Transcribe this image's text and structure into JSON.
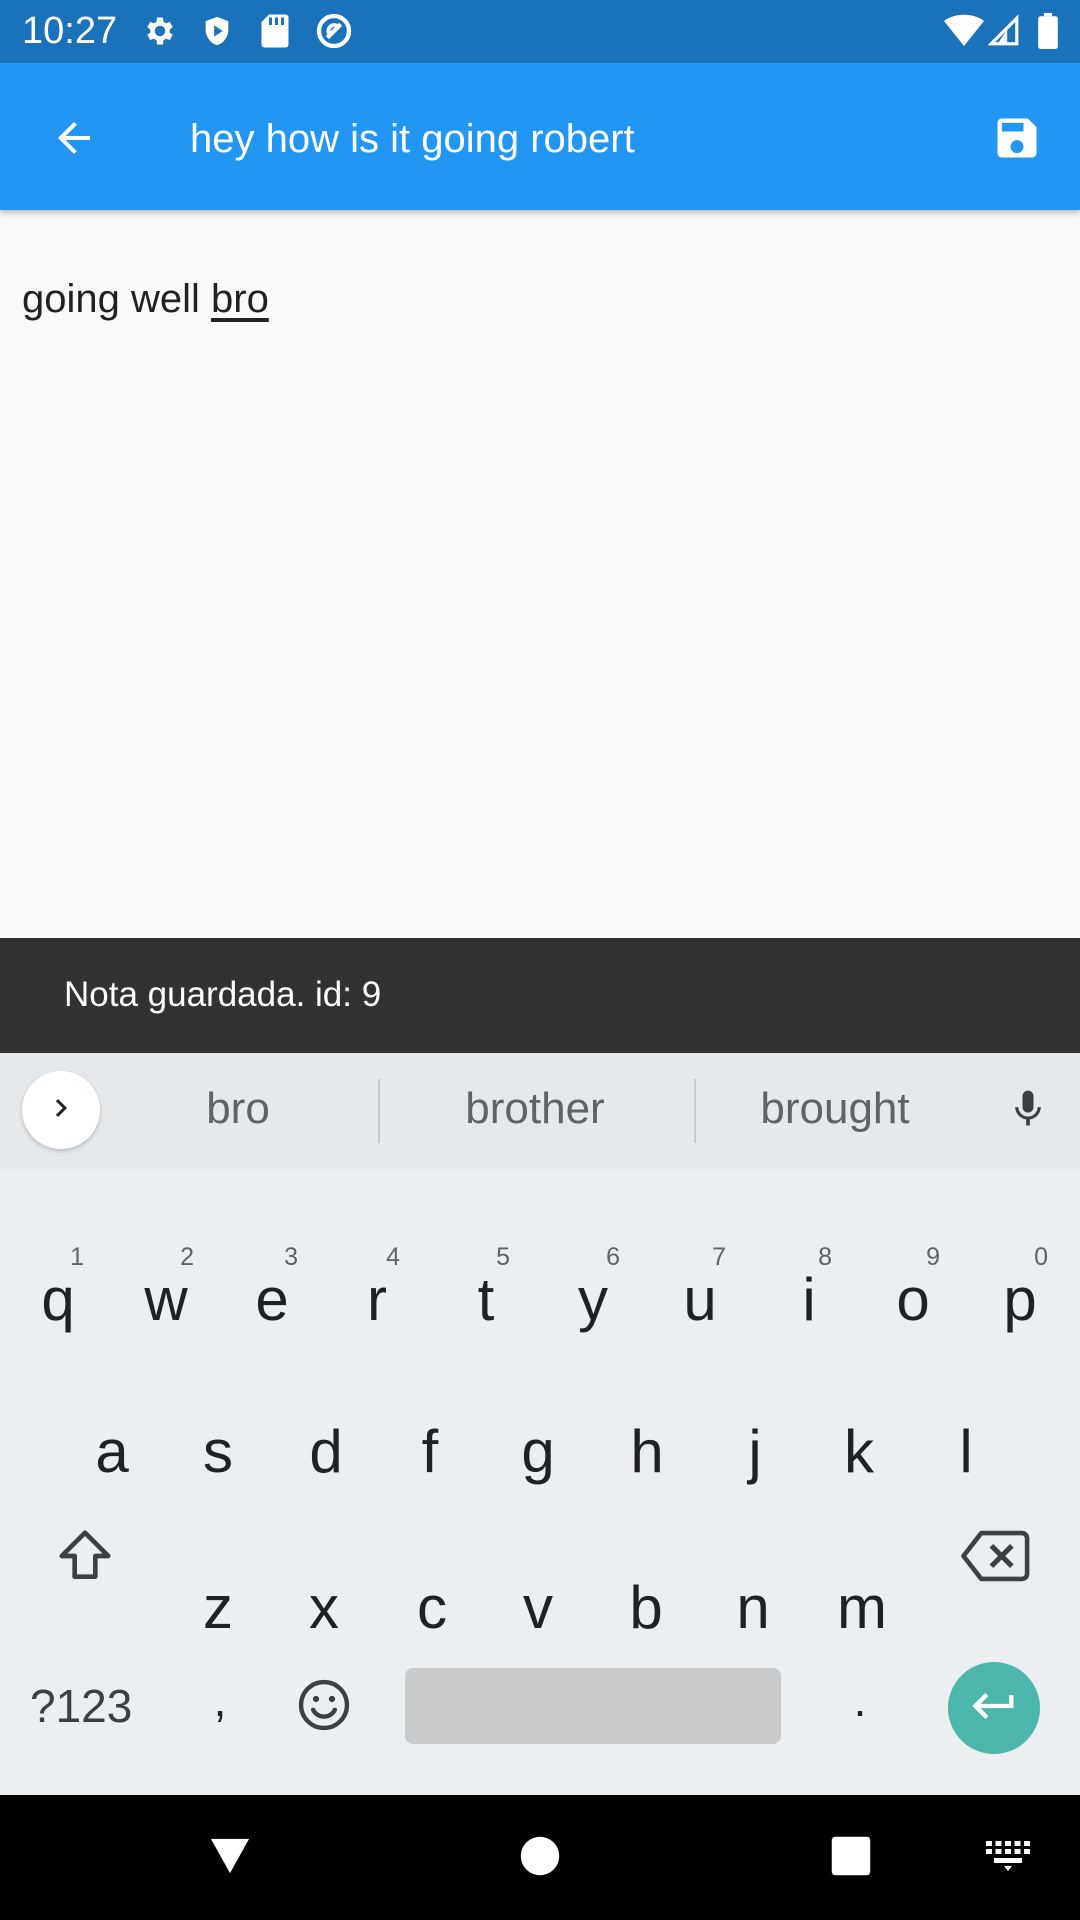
{
  "status_bar": {
    "time": "10:27",
    "left_icons": [
      "gear-icon",
      "shield-icon",
      "sd-card-icon",
      "at-sign-icon"
    ],
    "right_icons": [
      "wifi-icon",
      "cell-signal-icon",
      "battery-icon"
    ]
  },
  "app_bar": {
    "title": "hey how is it going robert",
    "back_icon": "arrow-left-icon",
    "save_icon": "floppy-disk-icon",
    "color": "#2196f3"
  },
  "note": {
    "text_before": "going well ",
    "composing_word": "bro"
  },
  "snackbar": {
    "message": "Nota guardada. id: 9"
  },
  "keyboard": {
    "suggestions": [
      "bro",
      "brother",
      "brought"
    ],
    "row1": [
      {
        "ch": "q",
        "hint": "1"
      },
      {
        "ch": "w",
        "hint": "2"
      },
      {
        "ch": "e",
        "hint": "3"
      },
      {
        "ch": "r",
        "hint": "4"
      },
      {
        "ch": "t",
        "hint": "5"
      },
      {
        "ch": "y",
        "hint": "6"
      },
      {
        "ch": "u",
        "hint": "7"
      },
      {
        "ch": "i",
        "hint": "8"
      },
      {
        "ch": "o",
        "hint": "9"
      },
      {
        "ch": "p",
        "hint": "0"
      }
    ],
    "row2": [
      "a",
      "s",
      "d",
      "f",
      "g",
      "h",
      "j",
      "k",
      "l"
    ],
    "row3": [
      "z",
      "x",
      "c",
      "v",
      "b",
      "n",
      "m"
    ],
    "symbols_label": "?123",
    "comma_label": ",",
    "period_label": ".",
    "enter_color": "#4db6ac"
  },
  "nav_bar": {
    "icons": [
      "back-triangle-icon",
      "home-circle-icon",
      "recents-square-icon",
      "keyboard-switch-icon"
    ]
  }
}
